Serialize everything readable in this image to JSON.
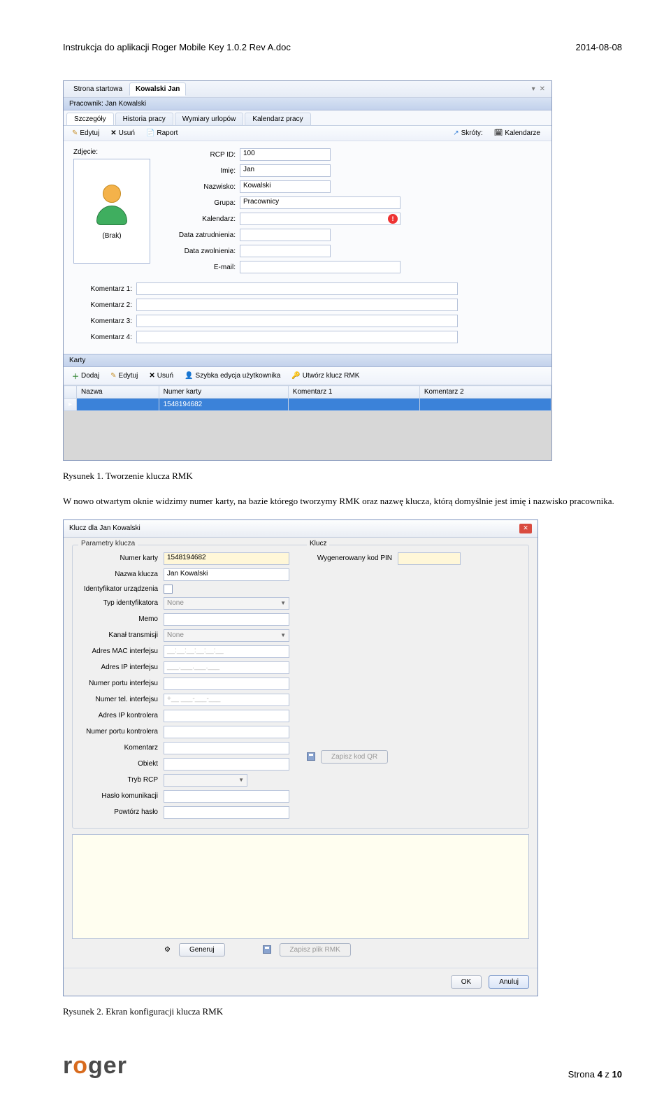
{
  "doc_header": {
    "left": "Instrukcja do aplikacji Roger Mobile Key 1.0.2 Rev A.doc",
    "right": "2014-08-08"
  },
  "win1": {
    "tabs_top": {
      "home": "Strona startowa",
      "active": "Kowalski Jan"
    },
    "subhead": "Pracownik: Jan Kowalski",
    "tabs2": [
      "Szczegóły",
      "Historia pracy",
      "Wymiary urlopów",
      "Kalendarz pracy"
    ],
    "tb": {
      "edit": "Edytuj",
      "del": "Usuń",
      "report": "Raport",
      "shortcuts": "Skróty:",
      "cal": "Kalendarze"
    },
    "photo": {
      "label": "Zdjęcie:",
      "none": "(Brak)"
    },
    "f": {
      "rcp": "RCP ID:",
      "rcp_v": "100",
      "imie": "Imię:",
      "imie_v": "Jan",
      "nazw": "Nazwisko:",
      "nazw_v": "Kowalski",
      "grupa": "Grupa:",
      "grupa_v": "Pracownicy",
      "kal": "Kalendarz:",
      "kal_v": "",
      "dz": "Data zatrudnienia:",
      "dz_v": "",
      "dzw": "Data zwolnienia:",
      "dzw_v": "",
      "email": "E-mail:",
      "email_v": "",
      "k1": "Komentarz 1:",
      "k2": "Komentarz 2:",
      "k3": "Komentarz 3:",
      "k4": "Komentarz 4:"
    },
    "section": "Karty",
    "tb2": {
      "add": "Dodaj",
      "edit": "Edytuj",
      "del": "Usuń",
      "quick": "Szybka edycja użytkownika",
      "create": "Utwórz klucz RMK"
    },
    "th": {
      "name": "Nazwa",
      "num": "Numer karty",
      "k1": "Komentarz 1",
      "k2": "Komentarz 2"
    },
    "row": {
      "num": "1548194682"
    }
  },
  "cap1": "Rysunek 1. Tworzenie klucza RMK",
  "para": "W nowo otwartym oknie widzimy numer karty, na bazie którego tworzymy RMK oraz nazwę klucza, którą domyślnie jest imię i nazwisko pracownika.",
  "dlg": {
    "title": "Klucz dla Jan Kowalski",
    "g1": "Parametry klucza",
    "g2": "Klucz",
    "f": {
      "num": "Numer karty",
      "num_v": "1548194682",
      "name": "Nazwa klucza",
      "name_v": "Jan Kowalski",
      "idu": "Identyfikator urządzenia",
      "typ": "Typ identyfikatora",
      "typ_v": "None",
      "memo": "Memo",
      "kanal": "Kanał transmisji",
      "kanal_v": "None",
      "mac": "Adres MAC interfejsu",
      "mac_v": "__:__:__:__:__:__",
      "ipi": "Adres IP interfejsu",
      "ipi_v": "___.___.___.___",
      "porti": "Numer portu interfejsu",
      "tel": "Numer tel. interfejsu",
      "tel_v": "+__ ___-___-___",
      "ipk": "Adres IP kontrolera",
      "portk": "Numer portu kontrolera",
      "kom": "Komentarz",
      "obj": "Obiekt",
      "tryb": "Tryb RCP",
      "haslo": "Hasło komunikacji",
      "powt": "Powtórz hasło",
      "pin": "Wygenerowany kod PIN"
    },
    "btns": {
      "qr": "Zapisz kod QR",
      "gen": "Generuj",
      "rmk": "Zapisz plik RMK",
      "ok": "OK",
      "cancel": "Anuluj"
    }
  },
  "cap2": "Rysunek 2. Ekran konfiguracji klucza RMK",
  "footer": {
    "page_pre": "Strona ",
    "page_n": "4",
    "page_mid": " z ",
    "page_total": "10",
    "logo_pre": "r",
    "logo_o": "o",
    "logo_post": "ger"
  }
}
